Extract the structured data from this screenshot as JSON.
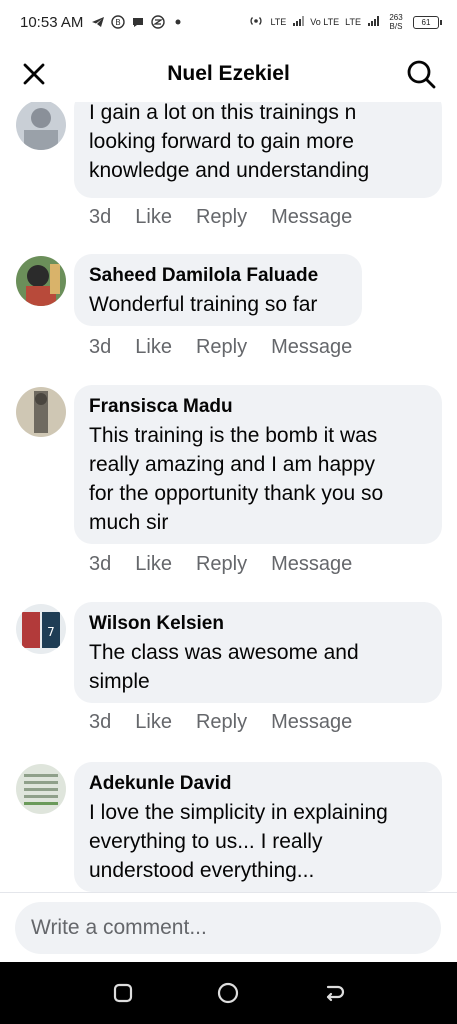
{
  "status_bar": {
    "time": "10:53 AM",
    "network_label_1": "LTE",
    "network_label_2": "Vo LTE",
    "network_label_3": "LTE",
    "speed": "263 B/S",
    "battery": "61"
  },
  "header": {
    "title": "Nuel Ezekiel"
  },
  "comments": [
    {
      "author": "",
      "text_lines": [
        "I gain a lot on this trainings n",
        "looking forward to gain more",
        "knowledge and understanding"
      ],
      "time": "3d",
      "like": "Like",
      "reply": "Reply",
      "message": "Message"
    },
    {
      "author": "Saheed Damilola Faluade",
      "text_lines": [
        "Wonderful training so far"
      ],
      "time": "3d",
      "like": "Like",
      "reply": "Reply",
      "message": "Message"
    },
    {
      "author": "Fransisca Madu",
      "text_lines": [
        "This training is the bomb it was",
        "really amazing and I am happy",
        "for the opportunity thank you so",
        "much sir"
      ],
      "time": "3d",
      "like": "Like",
      "reply": "Reply",
      "message": "Message"
    },
    {
      "author": "Wilson Kelsien",
      "text_lines": [
        "The class was awesome and",
        "simple"
      ],
      "time": "3d",
      "like": "Like",
      "reply": "Reply",
      "message": "Message"
    },
    {
      "author": "Adekunle David",
      "text_lines": [
        "I love the simplicity in explaining",
        "everything to us... I really",
        "understood everything..."
      ],
      "time": "",
      "like": "",
      "reply": "",
      "message": ""
    }
  ],
  "composer": {
    "placeholder": "Write a comment..."
  },
  "colors": {
    "bubble": "#f0f2f5",
    "meta_text": "#65676b",
    "nav_bg": "#000000"
  }
}
